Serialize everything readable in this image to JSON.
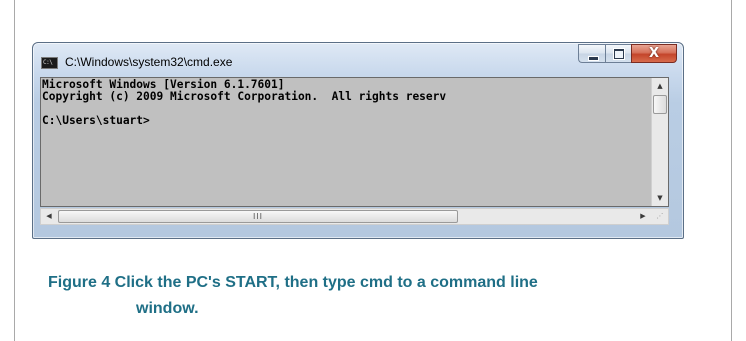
{
  "window": {
    "title": "C:\\Windows\\system32\\cmd.exe",
    "icon": "cmd-app-icon",
    "icon_text": "C:\\",
    "controls": {
      "minimize_icon": "minimize-icon",
      "maximize_icon": "maximize-icon",
      "close_glyph": "X"
    }
  },
  "console": {
    "background": "#c0c0c0",
    "foreground": "#000000",
    "lines": [
      "Microsoft Windows [Version 6.1.7601]",
      "Copyright (c) 2009 Microsoft Corporation.  All rights reserv",
      "",
      "C:\\Users\\stuart>"
    ]
  },
  "scrollbars": {
    "vertical": {
      "up_arrow": "▲",
      "down_arrow": "▼"
    },
    "horizontal": {
      "left_arrow": "◀",
      "right_arrow": "▶",
      "grip": "III"
    },
    "size_grip": "⋰"
  },
  "caption": {
    "line1": "Figure 4 Click the PC's START, then type cmd to a command line",
    "line2": "window.",
    "color": "#1f6f86"
  }
}
